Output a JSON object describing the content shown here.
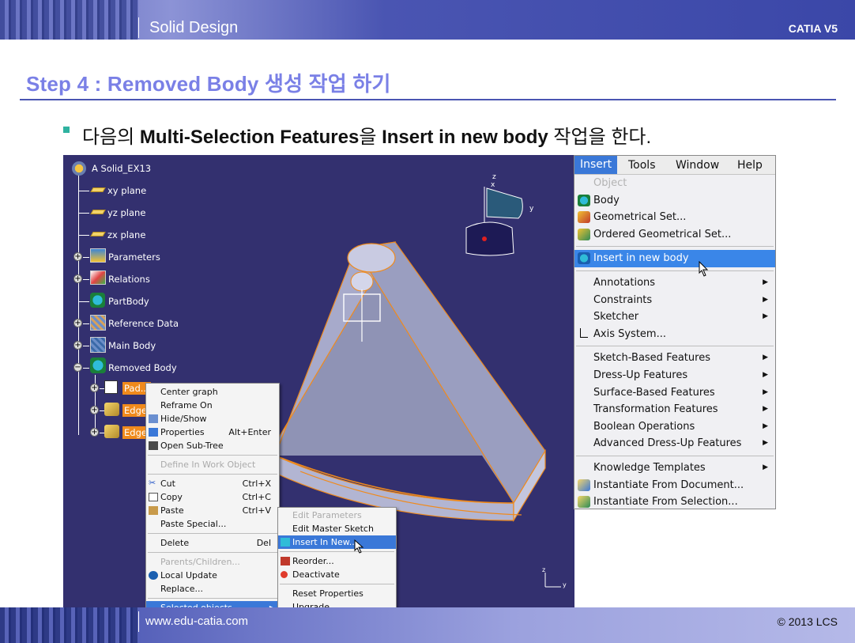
{
  "header": {
    "title": "Solid Design",
    "product": "CATIA V5"
  },
  "step": {
    "title": "Step 4 : Removed Body 생성 작업 하기"
  },
  "bullet": {
    "part1": "다음의 ",
    "bold1": "Multi-Selection Features",
    "part2": "을 ",
    "bold2": "Insert in new body",
    "part3": " 작업을 한다."
  },
  "tree": {
    "root": "A Solid_EX13",
    "items": [
      "xy plane",
      "yz plane",
      "zx plane",
      "Parameters",
      "Relations",
      "PartBody",
      "Reference Data",
      "Main Body",
      "Removed Body"
    ],
    "children": [
      "Pad...",
      "Edge",
      "Edge"
    ]
  },
  "viewport": {
    "axis_z": "z",
    "axis_x": "x",
    "axis_y": "y",
    "axis_small_z": "z",
    "axis_small_y": "y"
  },
  "context_menu": {
    "items": [
      {
        "label": "Center graph",
        "shortcut": ""
      },
      {
        "label": "Reframe On",
        "shortcut": ""
      },
      {
        "label": "Hide/Show",
        "shortcut": ""
      },
      {
        "label": "Properties",
        "shortcut": "Alt+Enter"
      },
      {
        "label": "Open Sub-Tree",
        "shortcut": ""
      },
      {
        "label": "Define In Work Object",
        "shortcut": ""
      },
      {
        "label": "Cut",
        "shortcut": "Ctrl+X"
      },
      {
        "label": "Copy",
        "shortcut": "Ctrl+C"
      },
      {
        "label": "Paste",
        "shortcut": "Ctrl+V"
      },
      {
        "label": "Paste Special...",
        "shortcut": ""
      },
      {
        "label": "Delete",
        "shortcut": "Del"
      },
      {
        "label": "Parents/Children...",
        "shortcut": ""
      },
      {
        "label": "Local Update",
        "shortcut": ""
      },
      {
        "label": "Replace...",
        "shortcut": ""
      },
      {
        "label": "Selected objects",
        "shortcut": ""
      }
    ]
  },
  "sub_menu": {
    "items": [
      "Edit Parameters",
      "Edit Master Sketch",
      "Insert In New...",
      "Reorder...",
      "Deactivate",
      "Reset Properties",
      "Upgrade"
    ]
  },
  "insert_menu": {
    "bar": [
      "Insert",
      "Tools",
      "Window",
      "Help"
    ],
    "items": [
      "Object",
      "Body",
      "Geometrical Set...",
      "Ordered Geometrical Set...",
      "Insert in new body",
      "Annotations",
      "Constraints",
      "Sketcher",
      "Axis System...",
      "Sketch-Based Features",
      "Dress-Up Features",
      "Surface-Based Features",
      "Transformation Features",
      "Boolean Operations",
      "Advanced Dress-Up Features",
      "Knowledge Templates",
      "Instantiate From Document...",
      "Instantiate From Selection..."
    ]
  },
  "footer": {
    "url": "www.edu-catia.com",
    "copyright": "© 2013 LCS"
  },
  "colors": {
    "header_blue": "#4a55b2",
    "step_title": "#7a80e6",
    "viewport_bg": "#33306f",
    "selection_orange": "#f08a1c",
    "menu_highlight": "#3a78d8"
  }
}
